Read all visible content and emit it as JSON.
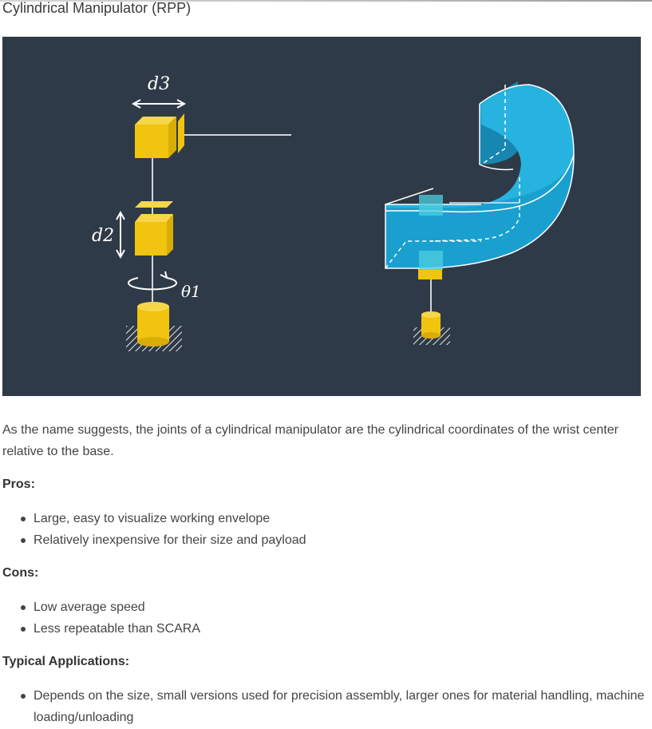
{
  "section": {
    "title": "Cylindrical Manipulator (RPP)"
  },
  "figure": {
    "labels": {
      "d3": "d3",
      "d2": "d2",
      "theta1": "θ1"
    },
    "colors": {
      "background": "#2f3a48",
      "joint_yellow": "#f1c40f",
      "workspace_blue": "#1aa0cf"
    }
  },
  "description": "As the name suggests, the joints of a cylindrical manipulator are the cylindrical coordinates of the wrist center relative to the base.",
  "pros": {
    "label": "Pros:",
    "items": [
      "Large, easy to visualize working envelope",
      "Relatively inexpensive for their size and payload"
    ]
  },
  "cons": {
    "label": "Cons:",
    "items": [
      "Low average speed",
      "Less repeatable than SCARA"
    ]
  },
  "applications": {
    "label": "Typical Applications:",
    "items": [
      "Depends on the size, small versions used for precision assembly, larger ones for material handling, machine loading/unloading"
    ]
  }
}
